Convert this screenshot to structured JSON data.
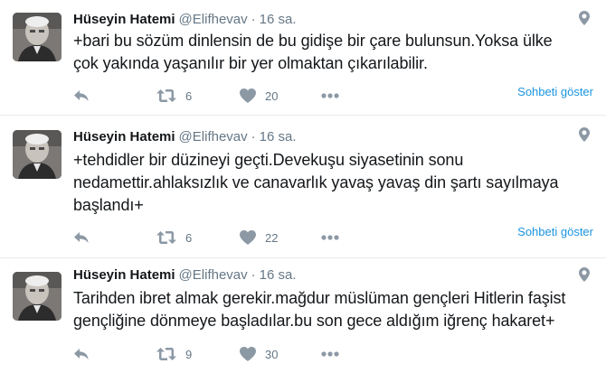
{
  "tweets": [
    {
      "name": "Hüseyin Hatemi",
      "handle": "@Elifhevav",
      "separator": "·",
      "time": "16 sa.",
      "lines": [
        "+bari bu sözüm dinlensin de bu gidişe bir çare bulunsun.Yoksa ülke",
        "çok yakında yaşanılır bir yer olmaktan çıkarılabilir."
      ],
      "retweets": "6",
      "likes": "20",
      "conversation_label": "Sohbeti göster"
    },
    {
      "name": "Hüseyin Hatemi",
      "handle": "@Elifhevav",
      "separator": "·",
      "time": "16 sa.",
      "lines": [
        "+tehdidler bir düzineyi geçti.Devekuşu siyasetinin sonu",
        "nedamettir.ahlaksızlık ve canavarlık yavaş yavaş din şartı sayılmaya",
        "başlandı+"
      ],
      "retweets": "6",
      "likes": "22",
      "conversation_label": "Sohbeti göster"
    },
    {
      "name": "Hüseyin Hatemi",
      "handle": "@Elifhevav",
      "separator": "·",
      "time": "16 sa.",
      "lines": [
        "Tarihden ibret almak gerekir.mağdur müslüman gençleri Hitlerin faşist",
        "gençliğine dönmeye başladılar.bu son gece aldığım iğrenç hakaret+"
      ],
      "retweets": "9",
      "likes": "30",
      "conversation_label": ""
    }
  ],
  "icons": {
    "avatar": "avatar-icon",
    "pin": "location-pin-icon",
    "reply": "reply-icon",
    "retweet": "retweet-icon",
    "like": "heart-icon",
    "more": "more-dots-icon"
  },
  "colors": {
    "text": "#14171a",
    "muted": "#657786",
    "icon": "#8c99a5",
    "link": "#1b95e0",
    "divider": "#e6ecf0"
  }
}
